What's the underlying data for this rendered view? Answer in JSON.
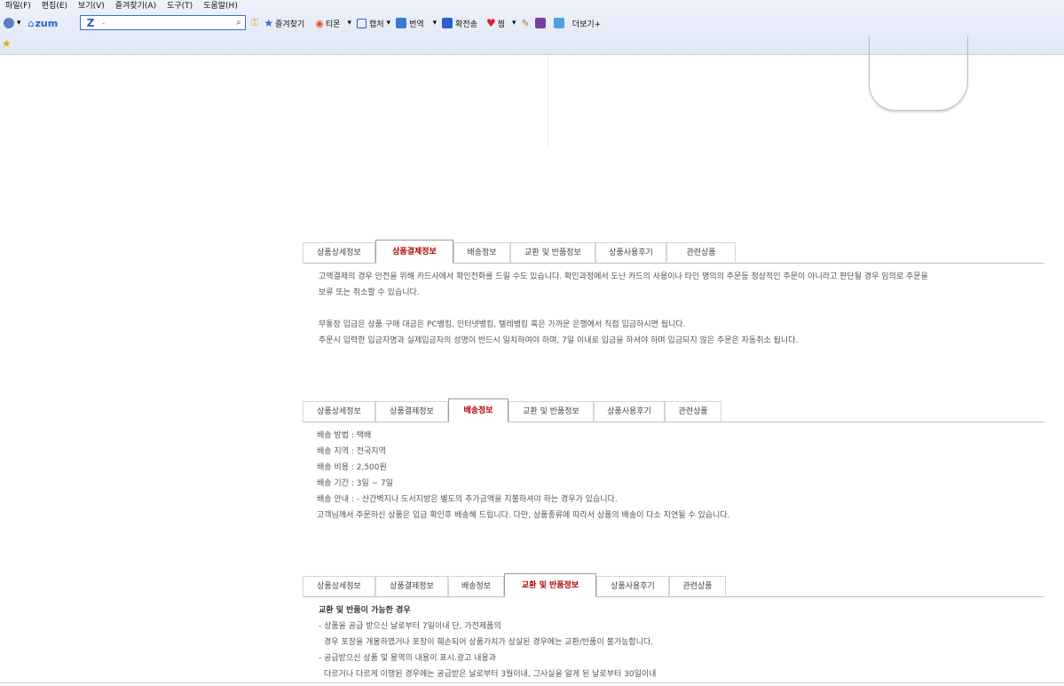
{
  "menu": [
    "파일(F)",
    "편집(E)",
    "보기(V)",
    "즐겨찾기(A)",
    "도구(T)",
    "도움말(H)"
  ],
  "toolbar": {
    "logo": "zum",
    "search_placeholder": "-",
    "items": [
      {
        "label": "즐겨찾기",
        "icon": "star-icon"
      },
      {
        "label": "티몬",
        "icon": "timon-icon"
      },
      {
        "label": "캡처",
        "icon": "capture-icon"
      },
      {
        "label": "번역",
        "icon": "translate-icon"
      },
      {
        "label": "확전송",
        "icon": "send-icon"
      },
      {
        "label": "찜",
        "icon": "heart-icon"
      }
    ],
    "more": "더보기+"
  },
  "tabs_labels": [
    "상품상세정보",
    "상품결제정보",
    "배송정보",
    "교환 및 반품정보",
    "상품사용후기",
    "관련상품"
  ],
  "payment": {
    "lines": [
      "고액결제의 경우 안전을 위해 카드사에서 확인전화를 드릴 수도 있습니다. 확인과정에서 도난 카드의 사용이나 타인 명의의 주문등 정상적인 주문이 아니라고 판단될 경우 임의로 주문을",
      "보류 또는 취소할 수 있습니다.",
      "",
      "무통장 입금은 상품 구매 대금은 PC뱅킹, 인터넷뱅킹, 텔레뱅킹 혹은 가까운 은행에서 직접 입금하시면 됩니다.",
      "주문시 입력한 입금자명과 실제입금자의 성명이 반드시 일치하여야 하며, 7일 이내로 입금을 하셔야 하며 입금되지 않은 주문은 자동취소 됩니다."
    ]
  },
  "shipping": {
    "lines": [
      "배송 방법 : 택배",
      "배송 지역 : 전국지역",
      "배송 비용 : 2,500원",
      "배송 기간 : 3일 ~ 7일",
      "배송 안내 : - 산간벽지나 도서지방은 별도의 추가금액을 지불하셔야 하는 경우가 있습니다.",
      "고객님께서 주문하신 상품은 입금 확인후 배송해 드립니다. 다만, 상품종류에 따라서 상품의 배송이 다소 지연될 수 있습니다."
    ]
  },
  "exchange": {
    "heading": "교환 및 반품이 가능한 경우",
    "lines": [
      "- 상품을 공급 받으신 날로부터 7일이내 단, 가전제품의",
      "  경우 포장을 개봉하였거나 포장이 훼손되어 상품가치가 상실된 경우에는 교환/반품이 불가능합니다.",
      "- 공급받으신 상품 및 용역의 내용이 표시.광고 내용과",
      "  다르거나 다르게 이행된 경우에는 공급받은 날로부터 3월이내, 그사실을 알게 된 날로부터 30일이내"
    ]
  }
}
